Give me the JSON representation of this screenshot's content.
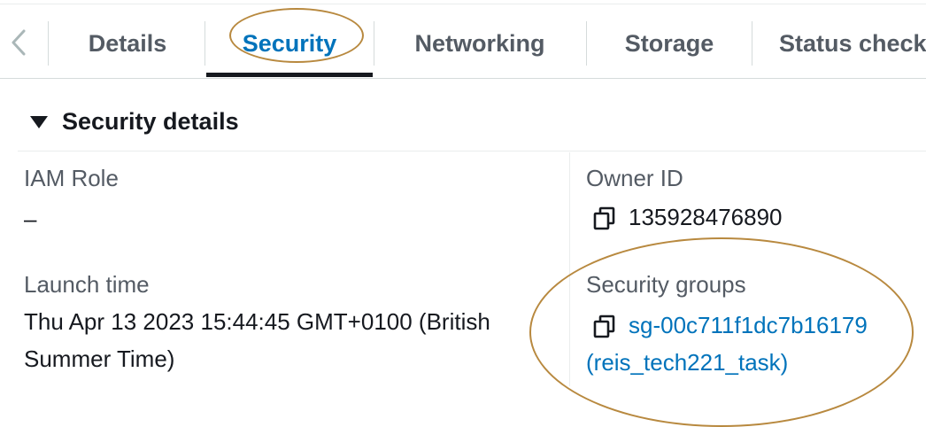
{
  "tabs": {
    "items": [
      {
        "label": "Details",
        "active": false
      },
      {
        "label": "Security",
        "active": true
      },
      {
        "label": "Networking",
        "active": false
      },
      {
        "label": "Storage",
        "active": false
      },
      {
        "label": "Status check",
        "active": false
      }
    ]
  },
  "section": {
    "title": "Security details",
    "iam_role": {
      "label": "IAM Role",
      "value": "–"
    },
    "owner_id": {
      "label": "Owner ID",
      "value": "135928476890"
    },
    "launch_time": {
      "label": "Launch time",
      "line1": "Thu Apr 13 2023 15:44:45 GMT+0100 (British",
      "line2": "Summer Time)"
    },
    "security_groups": {
      "label": "Security groups",
      "link_line1": "sg-00c711f1dc7b16179",
      "link_line2": "(reis_tech221_task)"
    }
  },
  "colors": {
    "link": "#0073bb",
    "annotation": "#b8893f",
    "active_underline": "#16191f"
  }
}
